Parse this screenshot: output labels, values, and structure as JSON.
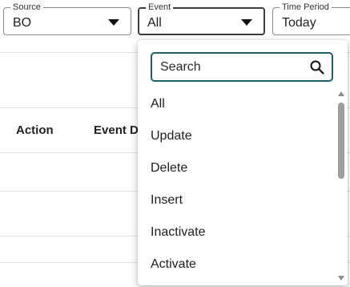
{
  "filters": {
    "source": {
      "label": "Source",
      "value": "BO"
    },
    "event": {
      "label": "Event",
      "value": "All"
    },
    "time_period": {
      "label": "Time Period",
      "value": "Today"
    }
  },
  "table": {
    "headers": [
      "Action",
      "Event Da"
    ]
  },
  "dropdown": {
    "search_placeholder": "Search",
    "options": [
      "All",
      "Update",
      "Delete",
      "Insert",
      "Inactivate",
      "Activate"
    ]
  }
}
